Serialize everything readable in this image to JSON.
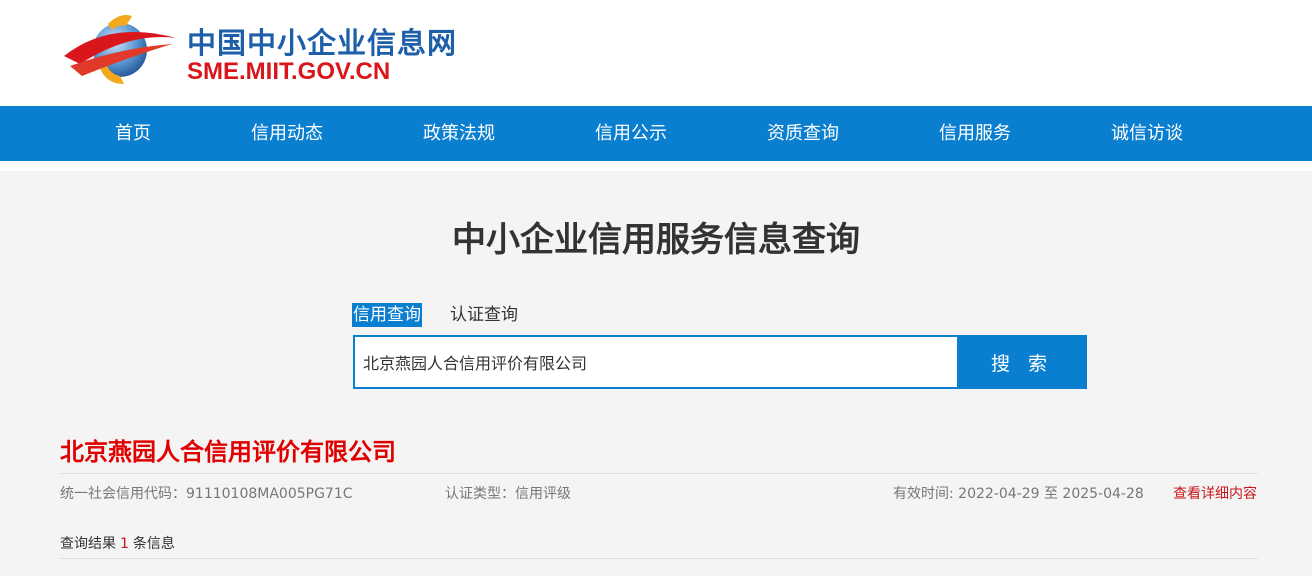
{
  "brand": {
    "title_cn": "中国中小企业信息网",
    "title_en": "SME.MIIT.GOV.CN",
    "icon": "globe-arc-logo-icon",
    "colors": {
      "primary": "#1d5fa8",
      "accent": "#d9161c"
    }
  },
  "nav": {
    "items": [
      {
        "label": "首页"
      },
      {
        "label": "信用动态"
      },
      {
        "label": "政策法规"
      },
      {
        "label": "信用公示"
      },
      {
        "label": "资质查询"
      },
      {
        "label": "信用服务"
      },
      {
        "label": "诚信访谈"
      }
    ],
    "color": "#0a7fcf"
  },
  "main": {
    "title": "中小企业信用服务信息查询",
    "tabs": [
      {
        "label": "信用查询",
        "active": true
      },
      {
        "label": "认证查询",
        "active": false
      }
    ],
    "search": {
      "value": "北京燕园人合信用评价有限公司",
      "button_label": "搜 索"
    }
  },
  "result": {
    "company_name": "北京燕园人合信用评价有限公司",
    "credit_code": "统一社会信用代码：91110108MA005PG71C",
    "cert_type": "认证类型：信用评级",
    "validity": "有效时间: 2022-04-29 至 2025-04-28",
    "detail_link": "查看详细内容"
  },
  "summary": {
    "prefix": "查询结果",
    "count": "1",
    "suffix": "条信息"
  }
}
